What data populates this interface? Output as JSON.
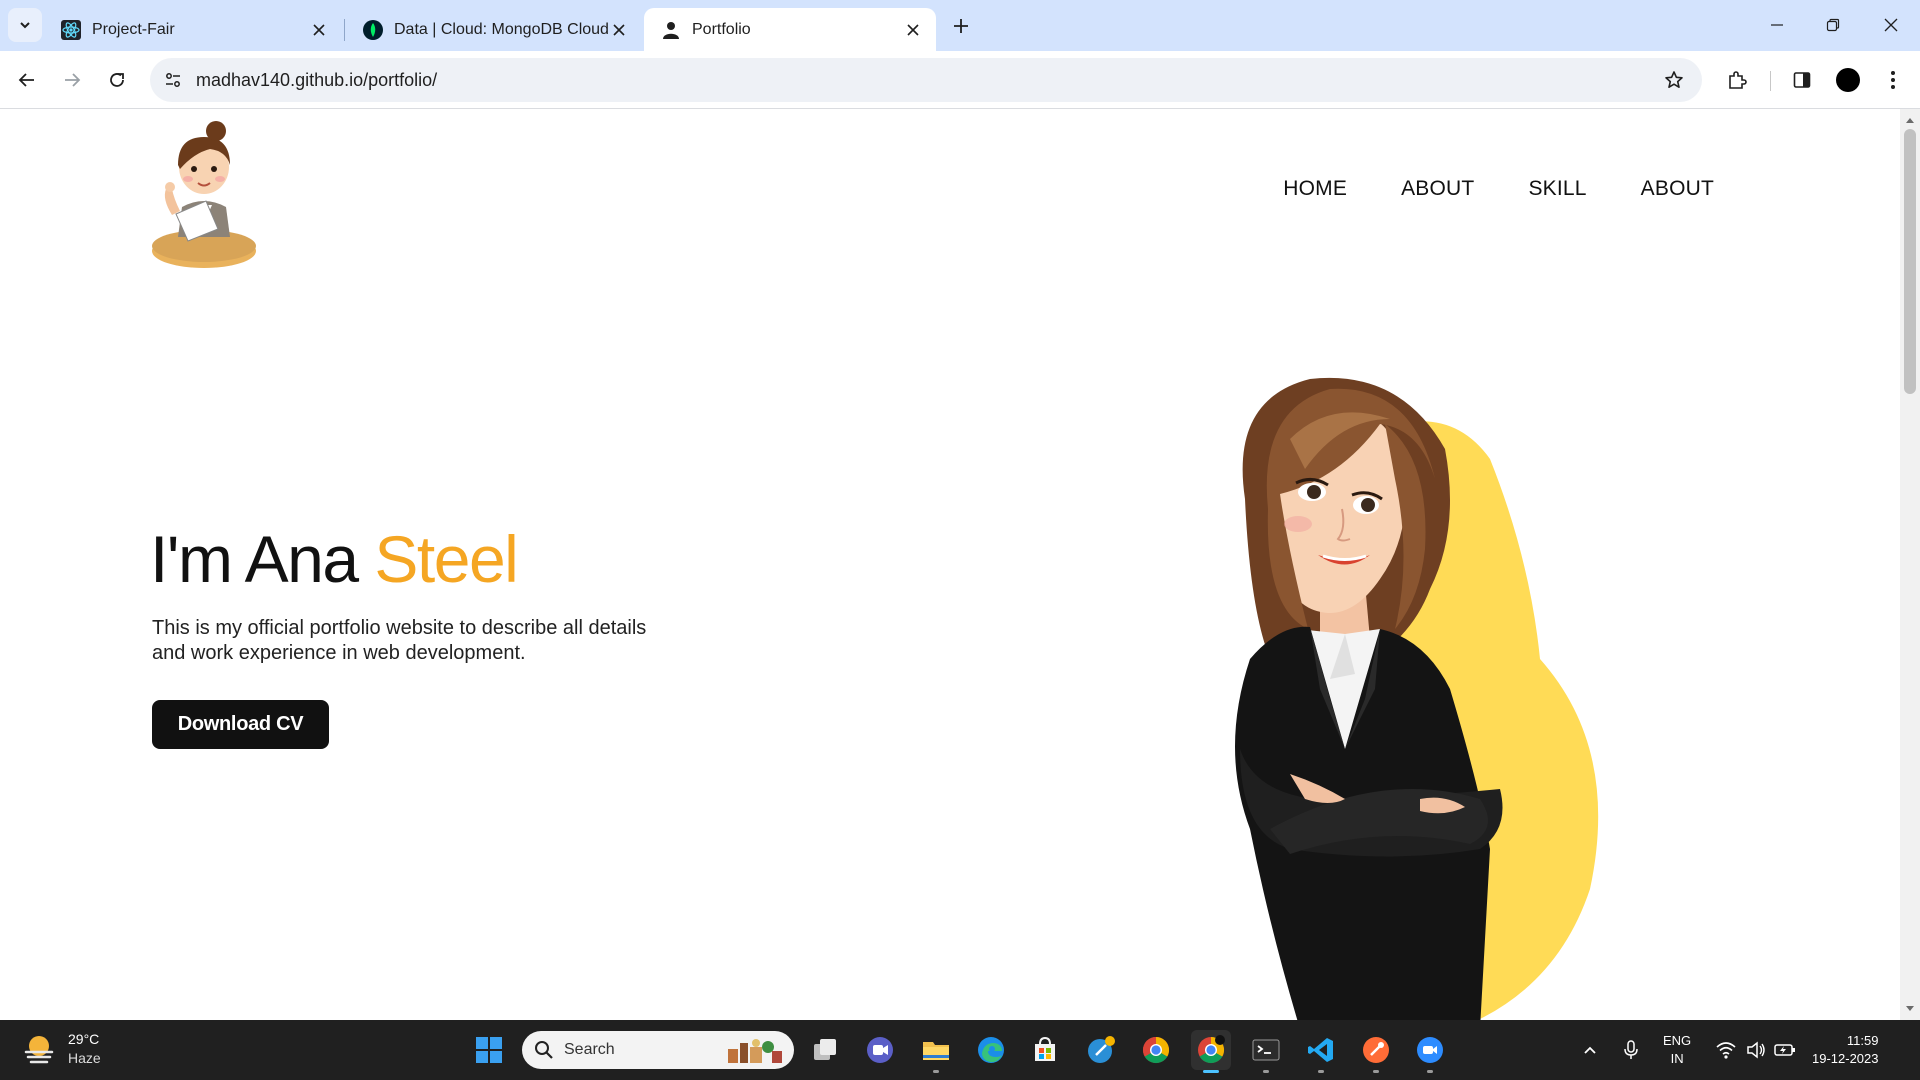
{
  "browser": {
    "tabs": [
      {
        "title": "Project-Fair",
        "icon": "react-icon",
        "active": false
      },
      {
        "title": "Data | Cloud: MongoDB Cloud",
        "icon": "mongodb-leaf-icon",
        "active": false
      },
      {
        "title": "Portfolio",
        "icon": "person-icon",
        "active": true
      }
    ],
    "url": "madhav140.github.io/portfolio/"
  },
  "page": {
    "nav": [
      "HOME",
      "ABOUT",
      "SKILL",
      "ABOUT"
    ],
    "hero": {
      "title_prefix": "I'm Ana ",
      "title_accent": "Steel",
      "description": "This is my official portfolio website to describe all details and work experience in web development.",
      "cta": "Download CV"
    },
    "colors": {
      "accent": "#f5a623",
      "button": "#111111",
      "blob": "#ffdb56"
    }
  },
  "taskbar": {
    "weather": {
      "temp": "29°C",
      "condition": "Haze"
    },
    "search_placeholder": "Search",
    "apps": [
      "windows-start-icon",
      "task-view-icon",
      "teams-icon",
      "file-explorer-icon",
      "edge-icon",
      "store-icon",
      "chatgpt-icon",
      "chrome-icon",
      "chrome-active-icon",
      "terminal-icon",
      "vscode-icon",
      "postman-icon",
      "zoom-icon"
    ],
    "language": {
      "line1": "ENG",
      "line2": "IN"
    },
    "clock": {
      "time": "11:59",
      "date": "19-12-2023"
    }
  }
}
